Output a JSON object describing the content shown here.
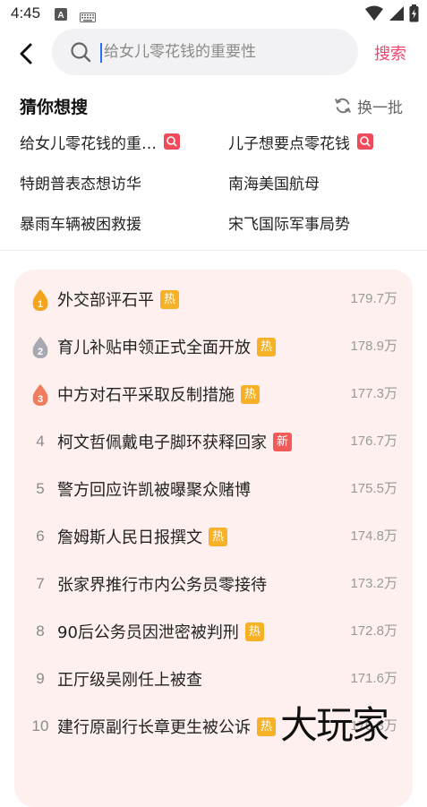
{
  "status_bar": {
    "time": "4:45"
  },
  "search": {
    "placeholder": "给女儿零花钱的重要性",
    "button_label": "搜索"
  },
  "guess": {
    "title": "猜你想搜",
    "refresh_label": "换一批",
    "items": [
      {
        "label": "给女儿零花钱的重…",
        "tag": true
      },
      {
        "label": "儿子想要点零花钱",
        "tag": true
      },
      {
        "label": "特朗普表态想访华",
        "tag": false
      },
      {
        "label": "南海美国航母",
        "tag": false
      },
      {
        "label": "暴雨车辆被困救援",
        "tag": false
      },
      {
        "label": "宋飞国际军事局势",
        "tag": false
      }
    ]
  },
  "hot_list": {
    "items": [
      {
        "rank": "1",
        "title": "外交部评石平",
        "badge": "热",
        "badge_type": "hot",
        "count": "179.7万"
      },
      {
        "rank": "2",
        "title": "育儿补贴申领正式全面开放",
        "badge": "热",
        "badge_type": "hot",
        "count": "178.9万"
      },
      {
        "rank": "3",
        "title": "中方对石平采取反制措施",
        "badge": "热",
        "badge_type": "hot",
        "count": "177.3万"
      },
      {
        "rank": "4",
        "title": "柯文哲佩戴电子脚环获释回家",
        "badge": "新",
        "badge_type": "new",
        "count": "176.7万"
      },
      {
        "rank": "5",
        "title": "警方回应许凯被曝聚众赌博",
        "badge": "",
        "badge_type": "",
        "count": "175.5万"
      },
      {
        "rank": "6",
        "title": "詹姆斯人民日报撰文",
        "badge": "热",
        "badge_type": "hot",
        "count": "174.8万"
      },
      {
        "rank": "7",
        "title": "张家界推行市内公务员零接待",
        "badge": "",
        "badge_type": "",
        "count": "173.2万"
      },
      {
        "rank": "8",
        "title": "90后公务员因泄密被判刑",
        "badge": "热",
        "badge_type": "hot",
        "count": "172.8万"
      },
      {
        "rank": "9",
        "title": "正厅级吴刚任上被查",
        "badge": "",
        "badge_type": "",
        "count": "171.6万"
      },
      {
        "rank": "10",
        "title": "建行原副行长章更生被公诉",
        "badge": "热",
        "badge_type": "hot",
        "count": "170.3万"
      }
    ]
  },
  "watermark": "大玩家",
  "colors": {
    "accent": "#f0446f",
    "hot_badge": "#f6b126",
    "new_badge": "#f25a5a",
    "search_tag": "#f14b5b",
    "card_bg": "#fdf0ee",
    "gold": "#f3a31d",
    "silver": "#a7a9b0",
    "bronze": "#ef7d5d"
  }
}
